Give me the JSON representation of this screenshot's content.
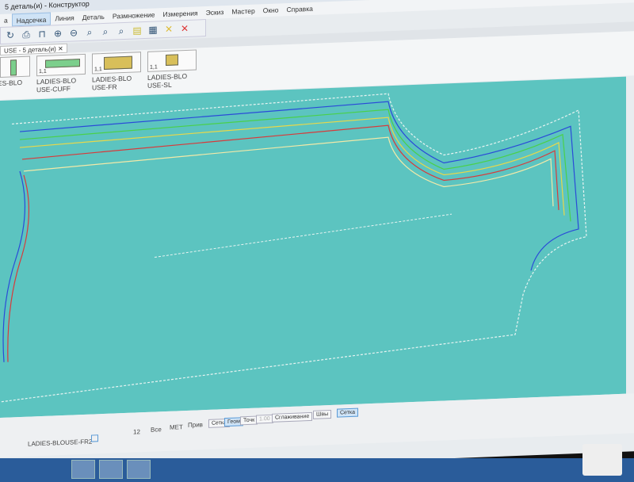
{
  "window": {
    "title": "5 деталь(и) - Конструктор"
  },
  "menu": [
    "а",
    "Надсечка",
    "Линия",
    "Деталь",
    "Размножение",
    "Измерения",
    "Эскиз",
    "Мастер",
    "Окно",
    "Справка"
  ],
  "toolbar": {
    "icons": [
      "redo-icon",
      "print-icon",
      "plotter-icon",
      "zoom-in-icon",
      "zoom-out-icon",
      "zoom-piece-icon",
      "zoom-all-icon",
      "zoom-1-1-icon",
      "layout-icon",
      "sheet-icon",
      "delete-yellow-icon",
      "delete-red-icon"
    ]
  },
  "tab": {
    "label": "USE - 5 деталь(и)",
    "close": "✕"
  },
  "pieces": [
    {
      "scale": "",
      "name": "LADIES-BLO\nOL"
    },
    {
      "scale": "1,1",
      "name": "LADIES-BLO\nUSE-CUFF"
    },
    {
      "scale": "1,1",
      "name": "LADIES-BLO\nUSE-FR"
    },
    {
      "scale": "1,1",
      "name": "LADIES-BLO\nUSE-SL"
    }
  ],
  "status": {
    "piece": "LADIES-BLOUSE-FR2",
    "size": "12",
    "all": "Все",
    "units": "МЕТ",
    "snap": "Прив",
    "buttons": [
      "Сетка",
      "Геом",
      "Точк",
      "1.00",
      "Сглаживание",
      "Швы",
      "Сетка"
    ]
  },
  "colors": {
    "canvas": "#5cc4c0",
    "blue": "#2a4bd8",
    "red": "#d83a3a",
    "green": "#4ad04a",
    "yellow": "#e8d84a",
    "white": "#e8f4f2"
  }
}
